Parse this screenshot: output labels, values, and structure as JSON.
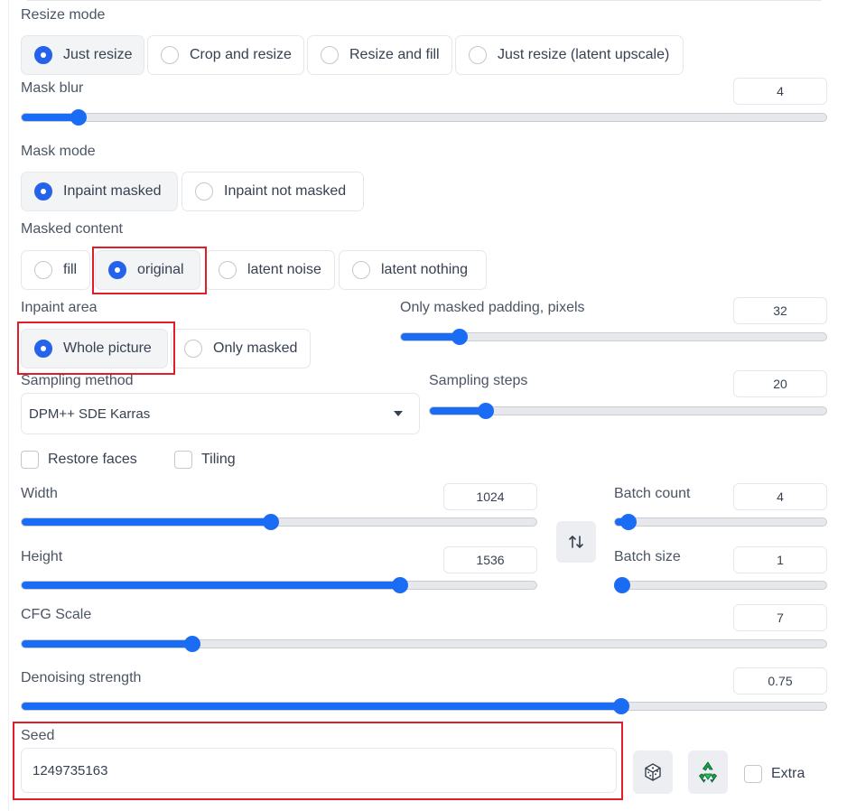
{
  "resize_mode": {
    "label": "Resize mode",
    "options": [
      "Just resize",
      "Crop and resize",
      "Resize and fill",
      "Just resize (latent upscale)"
    ],
    "selected": "Just resize"
  },
  "mask_blur": {
    "label": "Mask blur",
    "value": "4",
    "min": 0,
    "max": 64,
    "current": 4
  },
  "mask_mode": {
    "label": "Mask mode",
    "options": [
      "Inpaint masked",
      "Inpaint not masked"
    ],
    "selected": "Inpaint masked"
  },
  "masked_content": {
    "label": "Masked content",
    "options": [
      "fill",
      "original",
      "latent noise",
      "latent nothing"
    ],
    "selected": "original"
  },
  "inpaint_area": {
    "label": "Inpaint area",
    "options": [
      "Whole picture",
      "Only masked"
    ],
    "selected": "Whole picture"
  },
  "only_masked_padding": {
    "label": "Only masked padding, pixels",
    "value": "32",
    "min": 0,
    "max": 256,
    "current": 32
  },
  "sampling_method": {
    "label": "Sampling method",
    "value": "DPM++ SDE Karras"
  },
  "sampling_steps": {
    "label": "Sampling steps",
    "value": "20",
    "min": 1,
    "max": 150,
    "current": 20
  },
  "checkboxes": {
    "restore_faces": "Restore faces",
    "tiling": "Tiling"
  },
  "width": {
    "label": "Width",
    "value": "1024",
    "min": 64,
    "max": 2048,
    "current": 1024
  },
  "height": {
    "label": "Height",
    "value": "1536",
    "min": 64,
    "max": 2048,
    "current": 1536
  },
  "batch_count": {
    "label": "Batch count",
    "value": "4",
    "min": 1,
    "max": 100,
    "current": 4
  },
  "batch_size": {
    "label": "Batch size",
    "value": "1",
    "min": 1,
    "max": 8,
    "current": 1
  },
  "cfg_scale": {
    "label": "CFG Scale",
    "value": "7",
    "min": 1,
    "max": 30,
    "current": 7
  },
  "denoising_strength": {
    "label": "Denoising strength",
    "value": "0.75",
    "min": 0,
    "max": 1,
    "current": 0.75
  },
  "seed": {
    "label": "Seed",
    "value": "1249735163",
    "extra_label": "Extra"
  },
  "icons": {
    "swap": "swap-vertical-icon",
    "random": "dice-icon",
    "reuse": "recycle-icon"
  },
  "colors": {
    "accent": "#1a6cf5",
    "radio_selected": "#2563eb",
    "highlight": "#e11d2a"
  }
}
